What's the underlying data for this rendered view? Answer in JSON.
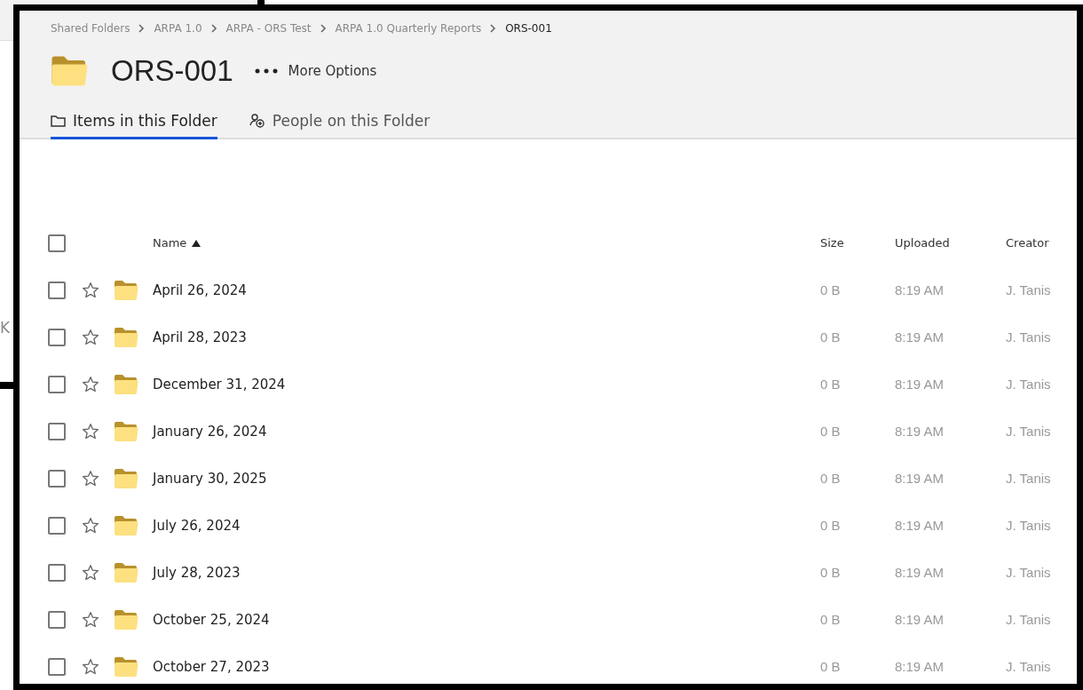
{
  "background_window": {
    "text_fragment": "K"
  },
  "breadcrumb": [
    {
      "label": "Shared Folders"
    },
    {
      "label": "ARPA 1.0"
    },
    {
      "label": "ARPA - ORS Test"
    },
    {
      "label": "ARPA 1.0 Quarterly Reports"
    },
    {
      "label": "ORS-001",
      "current": true
    }
  ],
  "folder": {
    "title": "ORS-001",
    "more_options": "More Options"
  },
  "tabs": [
    {
      "label": "Items in this Folder",
      "selected": true
    },
    {
      "label": "People on this Folder",
      "selected": false
    }
  ],
  "table": {
    "select_all": {
      "checked": false
    },
    "columns": [
      {
        "label": "Name",
        "sorted": true
      },
      {
        "label": "Size"
      },
      {
        "label": "Uploaded"
      },
      {
        "label": "Creator"
      }
    ],
    "rows": [
      {
        "name": "April 26, 2024",
        "size": "0 B",
        "uploaded": "8:19 AM",
        "creator": "J. Tanis",
        "checked": false,
        "starred": false
      },
      {
        "name": "April 28, 2023",
        "size": "0 B",
        "uploaded": "8:19 AM",
        "creator": "J. Tanis",
        "checked": false,
        "starred": false
      },
      {
        "name": "December 31, 2024",
        "size": "0 B",
        "uploaded": "8:19 AM",
        "creator": "J. Tanis",
        "checked": false,
        "starred": false
      },
      {
        "name": "January 26, 2024",
        "size": "0 B",
        "uploaded": "8:19 AM",
        "creator": "J. Tanis",
        "checked": false,
        "starred": false
      },
      {
        "name": "January 30, 2025",
        "size": "0 B",
        "uploaded": "8:19 AM",
        "creator": "J. Tanis",
        "checked": false,
        "starred": false
      },
      {
        "name": "July 26, 2024",
        "size": "0 B",
        "uploaded": "8:19 AM",
        "creator": "J. Tanis",
        "checked": false,
        "starred": false
      },
      {
        "name": "July 28, 2023",
        "size": "0 B",
        "uploaded": "8:19 AM",
        "creator": "J. Tanis",
        "checked": false,
        "starred": false
      },
      {
        "name": "October 25, 2024",
        "size": "0 B",
        "uploaded": "8:19 AM",
        "creator": "J. Tanis",
        "checked": false,
        "starred": false
      },
      {
        "name": "October 27, 2023",
        "size": "0 B",
        "uploaded": "8:19 AM",
        "creator": "J. Tanis",
        "checked": false,
        "starred": false
      }
    ]
  }
}
